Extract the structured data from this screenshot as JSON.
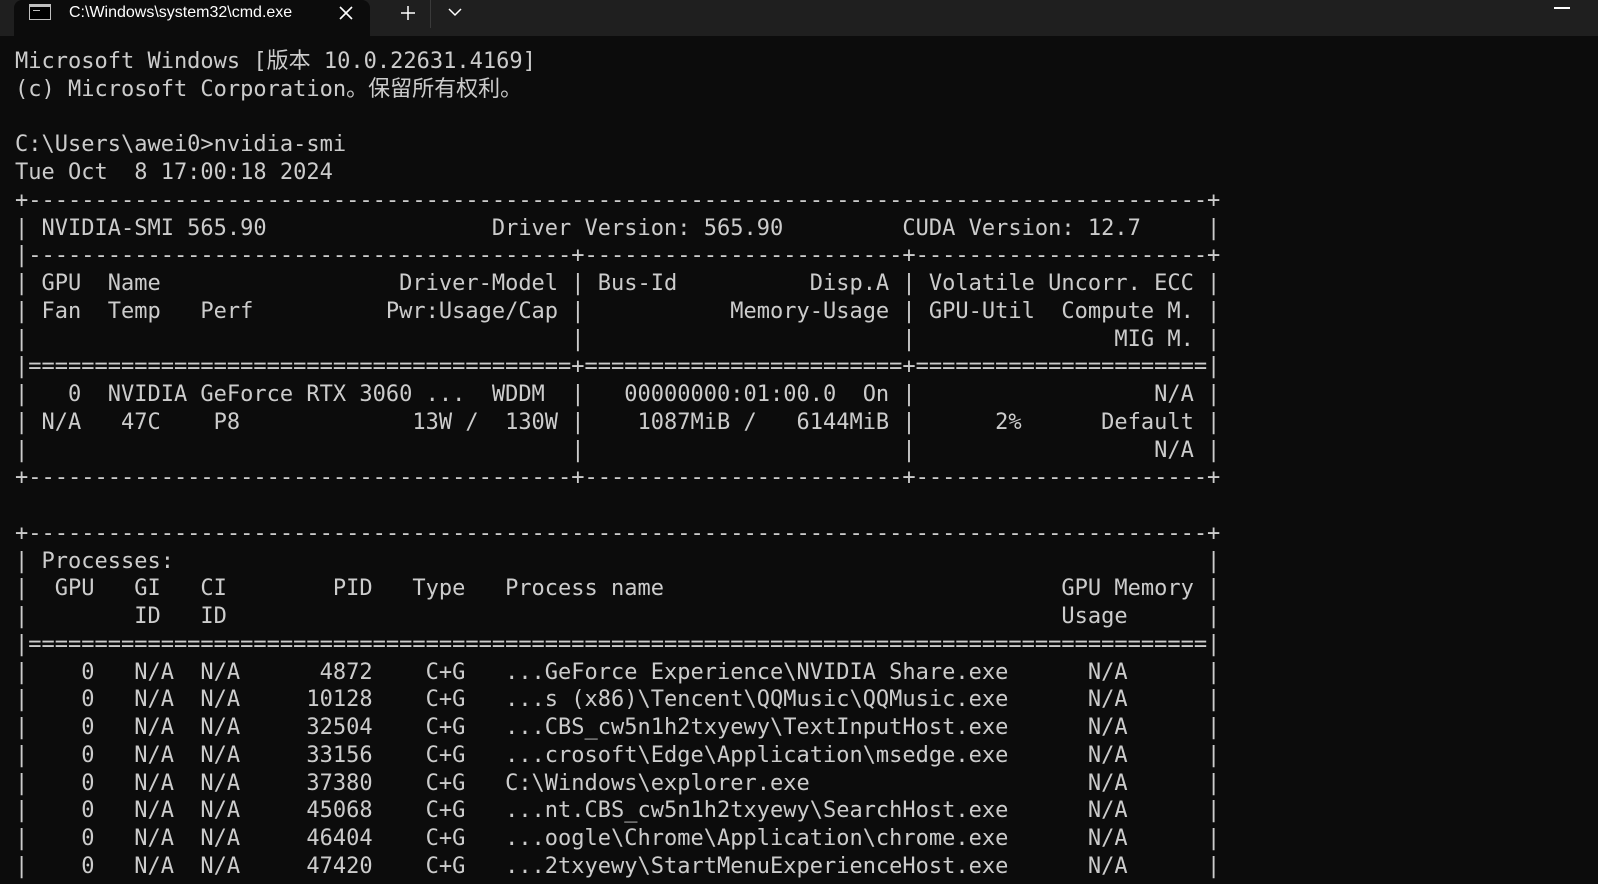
{
  "tab": {
    "title": "C:\\Windows\\system32\\cmd.exe",
    "icon": "cmd-icon",
    "close_icon": "close-icon"
  },
  "toolbar": {
    "new_tab_icon": "plus-icon",
    "dropdown_icon": "chevron-down-icon"
  },
  "window": {
    "minimize_icon": "minimize-icon"
  },
  "colors": {
    "console_background": "#0c0c0c",
    "console_text": "#cccccc",
    "tabbar_background": "#1f1f1f"
  },
  "console": {
    "lines": [
      "Microsoft Windows [版本 10.0.22631.4169]",
      "(c) Microsoft Corporation。保留所有权利。",
      "",
      "C:\\Users\\awei0>nvidia-smi",
      "Tue Oct  8 17:00:18 2024",
      "+-----------------------------------------------------------------------------------------+",
      "| NVIDIA-SMI 565.90                 Driver Version: 565.90         CUDA Version: 12.7     |",
      "|-----------------------------------------+------------------------+----------------------+",
      "| GPU  Name                  Driver-Model | Bus-Id          Disp.A | Volatile Uncorr. ECC |",
      "| Fan  Temp   Perf          Pwr:Usage/Cap |           Memory-Usage | GPU-Util  Compute M. |",
      "|                                         |                        |               MIG M. |",
      "|=========================================+========================+======================|",
      "|   0  NVIDIA GeForce RTX 3060 ...  WDDM  |   00000000:01:00.0  On |                  N/A |",
      "| N/A   47C    P8             13W /  130W |    1087MiB /   6144MiB |      2%      Default |",
      "|                                         |                        |                  N/A |",
      "+-----------------------------------------+------------------------+----------------------+",
      "",
      "+-----------------------------------------------------------------------------------------+",
      "| Processes:                                                                              |",
      "|  GPU   GI   CI        PID   Type   Process name                              GPU Memory |",
      "|        ID   ID                                                               Usage      |",
      "|=========================================================================================|",
      "|    0   N/A  N/A      4872    C+G   ...GeForce Experience\\NVIDIA Share.exe      N/A      |",
      "|    0   N/A  N/A     10128    C+G   ...s (x86)\\Tencent\\QQMusic\\QQMusic.exe      N/A      |",
      "|    0   N/A  N/A     32504    C+G   ...CBS_cw5n1h2txyewy\\TextInputHost.exe      N/A      |",
      "|    0   N/A  N/A     33156    C+G   ...crosoft\\Edge\\Application\\msedge.exe      N/A      |",
      "|    0   N/A  N/A     37380    C+G   C:\\Windows\\explorer.exe                     N/A      |",
      "|    0   N/A  N/A     45068    C+G   ...nt.CBS_cw5n1h2txyewy\\SearchHost.exe      N/A      |",
      "|    0   N/A  N/A     46404    C+G   ...oogle\\Chrome\\Application\\chrome.exe      N/A      |",
      "|    0   N/A  N/A     47420    C+G   ...2txyewy\\StartMenuExperienceHost.exe      N/A      |"
    ]
  }
}
